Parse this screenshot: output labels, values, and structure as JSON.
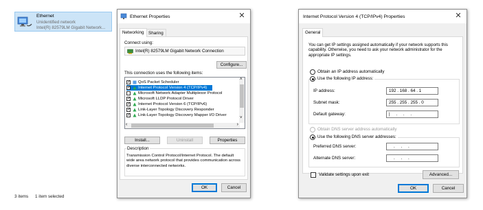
{
  "explorer": {
    "item_title": "Ethernet",
    "item_status": "Unidentified network",
    "item_adapter": "Intel(R) 82579LM Gigabit Network...",
    "status_items": "3 items",
    "status_selected": "1 item selected"
  },
  "eth_props": {
    "title": "Ethernet Properties",
    "tabs": [
      "Networking",
      "Sharing"
    ],
    "connect_using_label": "Connect using:",
    "adapter": "Intel(R) 82579LM Gigabit Network Connection",
    "configure": "Configure...",
    "items_label": "This connection uses the following items:",
    "items": [
      {
        "label": "QoS Packet Scheduler",
        "checked": true
      },
      {
        "label": "Internet Protocol Version 4 (TCP/IPv4)",
        "checked": true,
        "selected": true
      },
      {
        "label": "Microsoft Network Adapter Multiplexor Protocol",
        "checked": false
      },
      {
        "label": "Microsoft LLDP Protocol Driver",
        "checked": true
      },
      {
        "label": "Internet Protocol Version 6 (TCP/IPv6)",
        "checked": true
      },
      {
        "label": "Link-Layer Topology Discovery Responder",
        "checked": true
      },
      {
        "label": "Link-Layer Topology Discovery Mapper I/O Driver",
        "checked": true
      }
    ],
    "install": "Install...",
    "uninstall": "Uninstall",
    "properties": "Properties",
    "description_label": "Description",
    "description": "Transmission Control Protocol/Internet Protocol. The default wide area network protocol that provides communication across diverse interconnected networks.",
    "ok": "OK",
    "cancel": "Cancel"
  },
  "ipv4": {
    "title": "Internet Protocol Version 4 (TCP/IPv4) Properties",
    "tab": "General",
    "info": "You can get IP settings assigned automatically if your network supports this capability. Otherwise, you need to ask your network administrator for the appropriate IP settings.",
    "obtain_ip": "Obtain an IP address automatically",
    "use_ip": "Use the following IP address:",
    "ip_label": "IP address:",
    "ip_value": "192 . 168 . 64 . 1",
    "subnet_label": "Subnet mask:",
    "subnet_value": "255 . 255 . 255 . 0",
    "gateway_label": "Default gateway:",
    "gateway_value": "|     .     .     .",
    "obtain_dns": "Obtain DNS server address automatically",
    "use_dns": "Use the following DNS server addresses:",
    "preferred_label": "Preferred DNS server:",
    "preferred_value": "    .     .     .",
    "alternate_label": "Alternate DNS server:",
    "alternate_value": "    .     .     .",
    "validate": "Validate settings upon exit",
    "advanced": "Advanced...",
    "ok": "OK",
    "cancel": "Cancel"
  },
  "colors": {
    "accent": "#0078d7",
    "dialog_bg": "#f0f0f0",
    "selection_bg": "#cce4f7"
  }
}
